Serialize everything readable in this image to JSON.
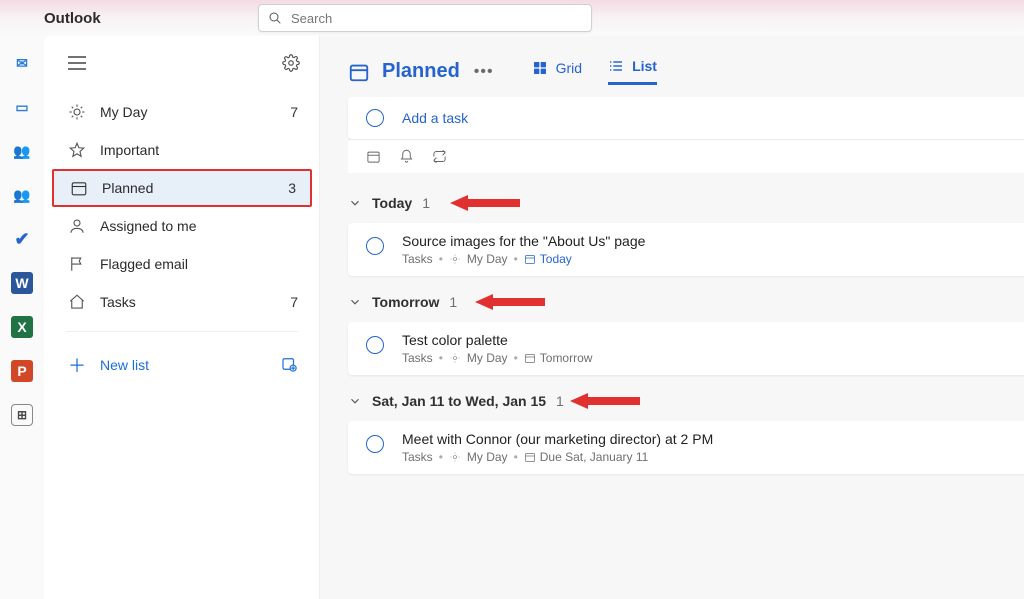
{
  "app": {
    "title": "Outlook"
  },
  "search": {
    "placeholder": "Search"
  },
  "sidebar": {
    "items": [
      {
        "label": "My Day",
        "count": "7",
        "selected": false
      },
      {
        "label": "Important",
        "count": "",
        "selected": false
      },
      {
        "label": "Planned",
        "count": "3",
        "selected": true
      },
      {
        "label": "Assigned to me",
        "count": "",
        "selected": false
      },
      {
        "label": "Flagged email",
        "count": "",
        "selected": false
      },
      {
        "label": "Tasks",
        "count": "7",
        "selected": false
      }
    ],
    "new_list": "New list"
  },
  "main": {
    "title": "Planned",
    "view": {
      "grid": "Grid",
      "list": "List"
    },
    "add_task": "Add a task",
    "tasks_list_label": "Tasks",
    "my_day_label": "My Day",
    "groups": [
      {
        "label": "Today",
        "count": "1",
        "arrow": true
      },
      {
        "label": "Tomorrow",
        "count": "1",
        "arrow": true
      },
      {
        "label": "Sat, Jan 11 to Wed, Jan 15",
        "count": "1",
        "arrow": true
      }
    ],
    "tasks": [
      {
        "title": "Source images for the \"About Us\" page",
        "due": "Today"
      },
      {
        "title": "Test color palette",
        "due": "Tomorrow"
      },
      {
        "title": "Meet with Connor (our marketing director) at 2 PM",
        "due": "Due Sat, January 11"
      }
    ]
  }
}
